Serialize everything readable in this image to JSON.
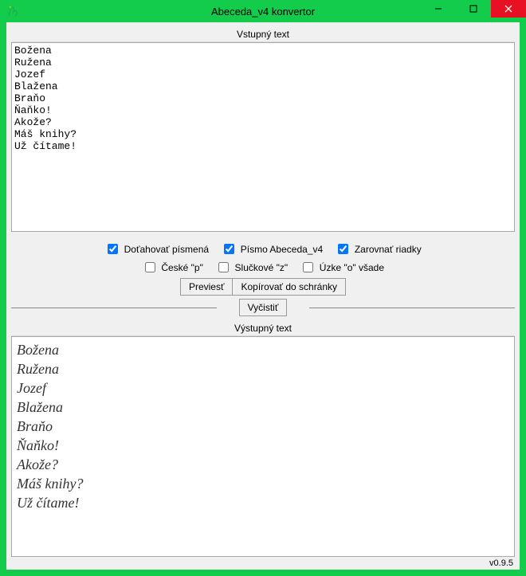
{
  "window": {
    "title": "Abeceda_v4 konvertor"
  },
  "labels": {
    "input_group": "Vstupný text",
    "output_group": "Výstupný text"
  },
  "input_text": "Božena\nRužena\nJozef\nBlažena\nBraňo\nŇaňko!\nAkože?\nMáš knihy?\nUž čítame!\n",
  "options": {
    "row1": [
      {
        "label": "Doťahovať písmená",
        "checked": true
      },
      {
        "label": "Písmo Abeceda_v4",
        "checked": true
      },
      {
        "label": "Zarovnať riadky",
        "checked": true
      }
    ],
    "row2": [
      {
        "label": "České \"p\"",
        "checked": false
      },
      {
        "label": "Slučkové \"z\"",
        "checked": false
      },
      {
        "label": "Úzke \"o\" všade",
        "checked": false
      }
    ]
  },
  "buttons": {
    "convert": "Previesť",
    "copy": "Kopírovať do schránky",
    "clear": "Vyčistiť"
  },
  "output_text": "Božena\nRužena\nJozef\nBlažena\nBraňo\nŇaňko!\nAkože?\nMáš knihy?\nUž čítame!",
  "version": "v0.9.5"
}
